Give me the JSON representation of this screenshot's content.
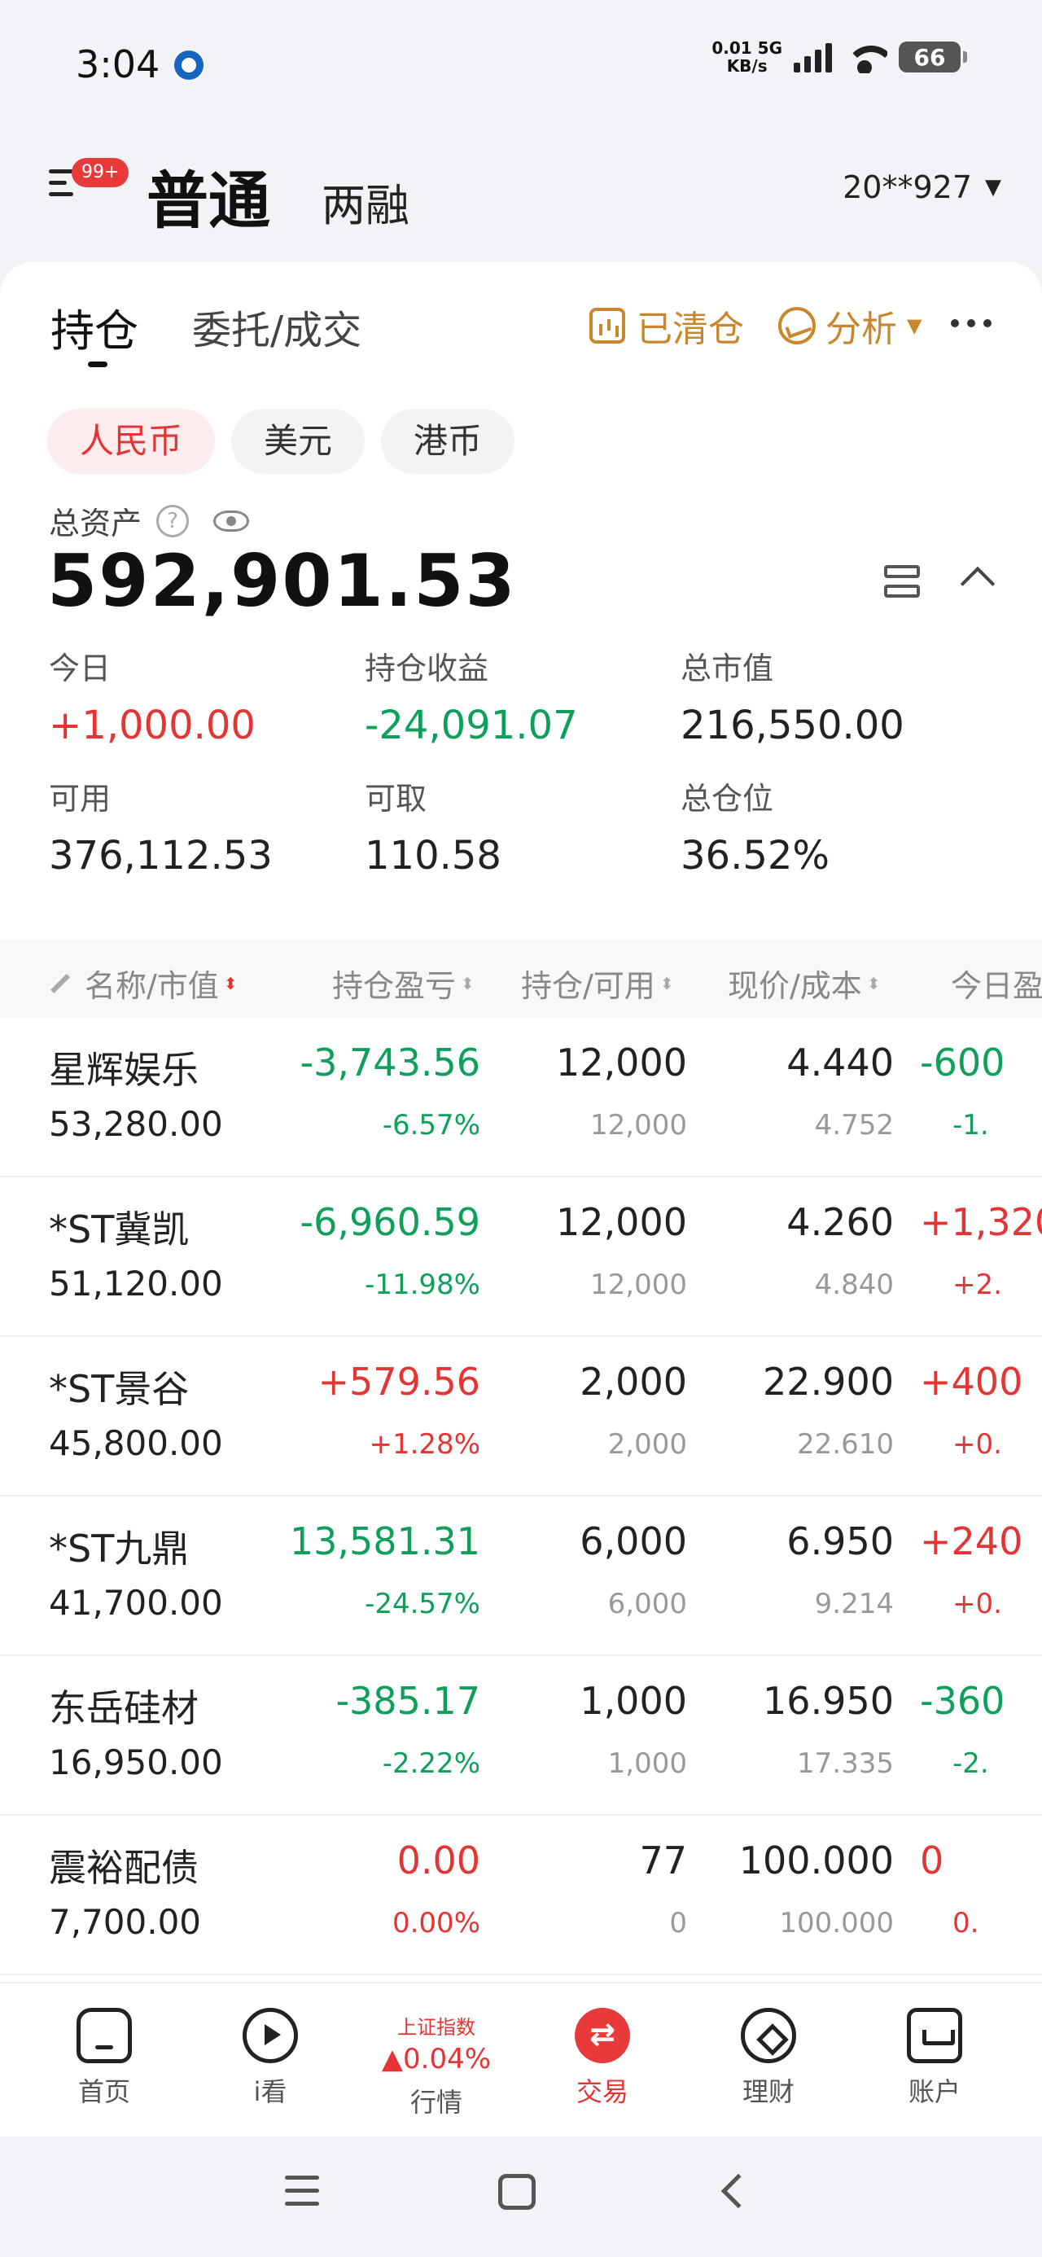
{
  "status_bar": {
    "time": "3:04",
    "net_speed": "0.01",
    "net_unit": "KB/s",
    "net_type": "5G",
    "battery": "66"
  },
  "header": {
    "badge": "99+",
    "tab_normal": "普通",
    "tab_margin": "两融",
    "account": "20**927"
  },
  "subtabs": {
    "positions": "持仓",
    "orders": "委托/成交",
    "cleared": "已清仓",
    "analysis": "分析"
  },
  "currency": [
    "人民币",
    "美元",
    "港币"
  ],
  "summary": {
    "total_label": "总资产",
    "help": "?",
    "total_value": "592,901.53",
    "stats": [
      {
        "label": "今日",
        "value": "+1,000.00",
        "trend": "up"
      },
      {
        "label": "持仓收益",
        "value": "-24,091.07",
        "trend": "down"
      },
      {
        "label": "总市值",
        "value": "216,550.00",
        "trend": "flat"
      },
      {
        "label": "可用",
        "value": "376,112.53",
        "trend": "flat"
      },
      {
        "label": "可取",
        "value": "110.58",
        "trend": "flat"
      },
      {
        "label": "总仓位",
        "value": "36.52%",
        "trend": "flat"
      }
    ]
  },
  "table": {
    "headers": [
      "名称/市值",
      "持仓盈亏",
      "持仓/可用",
      "现价/成本",
      "今日盈"
    ],
    "sort_glyph": "⬍",
    "rows": [
      {
        "name": "星辉娱乐",
        "market_value": "53,280.00",
        "pl": "-3,743.56",
        "pl_pct": "-6.57%",
        "qty": "12,000",
        "avail": "12,000",
        "price": "4.440",
        "cost": "4.752",
        "today": "-600",
        "today_pct": "-1.",
        "pl_trend": "down",
        "today_trend": "down"
      },
      {
        "name": "*ST冀凯",
        "market_value": "51,120.00",
        "pl": "-6,960.59",
        "pl_pct": "-11.98%",
        "qty": "12,000",
        "avail": "12,000",
        "price": "4.260",
        "cost": "4.840",
        "today": "+1,320",
        "today_pct": "+2.",
        "pl_trend": "down",
        "today_trend": "up"
      },
      {
        "name": "*ST景谷",
        "market_value": "45,800.00",
        "pl": "+579.56",
        "pl_pct": "+1.28%",
        "qty": "2,000",
        "avail": "2,000",
        "price": "22.900",
        "cost": "22.610",
        "today": "+400",
        "today_pct": "+0.",
        "pl_trend": "up",
        "today_trend": "up"
      },
      {
        "name": "*ST九鼎",
        "market_value": "41,700.00",
        "pl": "13,581.31",
        "pl_pct": "-24.57%",
        "qty": "6,000",
        "avail": "6,000",
        "price": "6.950",
        "cost": "9.214",
        "today": "+240",
        "today_pct": "+0.",
        "pl_trend": "down",
        "today_trend": "up"
      },
      {
        "name": "东岳硅材",
        "market_value": "16,950.00",
        "pl": "-385.17",
        "pl_pct": "-2.22%",
        "qty": "1,000",
        "avail": "1,000",
        "price": "16.950",
        "cost": "17.335",
        "today": "-360",
        "today_pct": "-2.",
        "pl_trend": "down",
        "today_trend": "down"
      },
      {
        "name": "震裕配债",
        "market_value": "7,700.00",
        "pl": "0.00",
        "pl_pct": "0.00%",
        "qty": "77",
        "avail": "0",
        "price": "100.000",
        "cost": "100.000",
        "today": "0",
        "today_pct": "0.",
        "pl_trend": "up",
        "today_trend": "up"
      }
    ]
  },
  "bottom_nav": {
    "home": "首页",
    "watch": "i看",
    "market": "行情",
    "index_name": "上证指数",
    "index_change": "▲0.04%",
    "trade": "交易",
    "wealth": "理财",
    "account": "账户"
  },
  "colors": {
    "up": "#e43434",
    "down": "#0ea05a",
    "accent": "#c9862c"
  },
  "icons": [
    "app-logo-icon",
    "signal-icon",
    "wifi-icon",
    "battery-icon",
    "menu-icon",
    "bar-chart-icon",
    "analysis-icon",
    "more-icon",
    "help-icon",
    "eye-icon",
    "layout-icon",
    "collapse-icon",
    "edit-icon",
    "sort-icon",
    "home-icon",
    "play-icon",
    "trade-icon",
    "wealth-icon",
    "account-icon"
  ]
}
